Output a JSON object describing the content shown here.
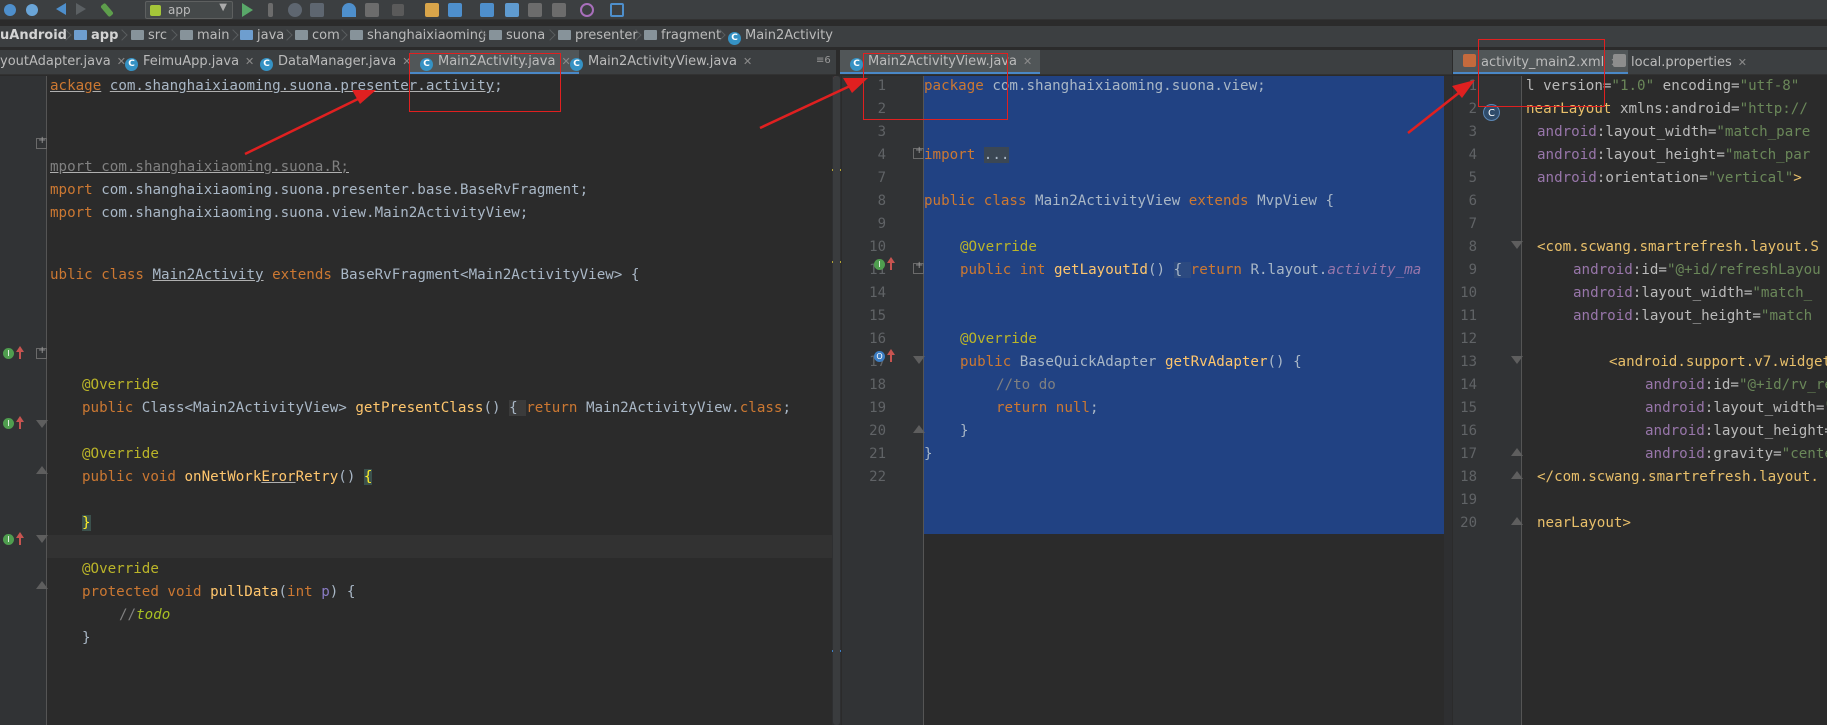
{
  "toolbar": {
    "run_config": "app",
    "icons": [
      "sync-icon",
      "back-icon",
      "forward-icon",
      "build-icon",
      "run-icon",
      "debug-icon",
      "profile-icon",
      "stop-icon",
      "avd-icon",
      "sdk-icon",
      "git-icon",
      "undo-icon",
      "layout-icon"
    ]
  },
  "breadcrumb": {
    "items": [
      "uAndroid",
      "app",
      "src",
      "main",
      "java",
      "com",
      "shanghaixiaoming",
      "suona",
      "presenter",
      "fragment",
      "Main2Activity"
    ]
  },
  "tabs_left": [
    "youtAdapter.java",
    "FeimuApp.java",
    "DataManager.java",
    "Main2Activity.java",
    "Main2ActivityView.java"
  ],
  "tabs_left_more": "≡6",
  "tabs_mid": [
    "Main2ActivityView.java"
  ],
  "tabs_right": [
    "activity_main2.xml",
    "local.properties"
  ],
  "left_code": [
    "package com.shanghaixiaoming.suona.presenter.activity;",
    "import com.shanghaixiaoming.suona.R;",
    "import com.shanghaixiaoming.suona.presenter.base.BaseRvFragment;",
    "import com.shanghaixiaoming.suona.view.Main2ActivityView;",
    "public class Main2Activity extends BaseRvFragment<Main2ActivityView> {",
    "@Override",
    "public Class<Main2ActivityView> getPresentClass() { return Main2ActivityView.class;",
    "@Override",
    "public void onNetWorkErorRetry() {",
    "}",
    "@Override",
    "protected void pullData(int p) {",
    "//todo",
    "}"
  ],
  "mid_line_numbers": [
    "1",
    "2",
    "3",
    "4",
    "7",
    "8",
    "9",
    "10",
    "11",
    "14",
    "15",
    "16",
    "17",
    "18",
    "19",
    "20",
    "21",
    "22"
  ],
  "mid_code": [
    "package com.shanghaixiaoming.suona.view;",
    "import ...",
    "public class Main2ActivityView extends MvpView {",
    "@Override",
    "public int getLayoutId() { return R.layout.activity_ma",
    "@Override",
    "public BaseQuickAdapter getRvAdapter() {",
    "//to do",
    "return null;",
    "}",
    "}"
  ],
  "right_line_numbers": [
    "1",
    "2",
    "3",
    "4",
    "5",
    "6",
    "7",
    "8",
    "9",
    "10",
    "11",
    "12",
    "13",
    "14",
    "15",
    "16",
    "17",
    "18",
    "19",
    "20"
  ],
  "right_code": [
    "l version=\"1.0\" encoding=\"utf-8\"",
    "nearLayout xmlns:android=\"http://",
    "android:layout_width=\"match_pare",
    "android:layout_height=\"match_par",
    "android:orientation=\"vertical\">",
    "<com.scwang.smartrefresh.layout.S",
    "android:id=\"@+id/refreshLayou",
    "android:layout_width=\"match_",
    "android:layout_height=\"match",
    "<android.support.v7.widget.Re",
    "android:id=\"@+id/rv_reco",
    "android:layout_width=\"ma",
    "android:layout_height=\"m",
    "android:gravity=\"center\"",
    "</com.scwang.smartrefresh.layout.",
    "nearLayout>"
  ],
  "colors": {
    "annotation_red": "#e02020",
    "selection": "#214283",
    "keyword": "#cc7832",
    "function": "#ffc66d",
    "string": "#6a8759"
  }
}
